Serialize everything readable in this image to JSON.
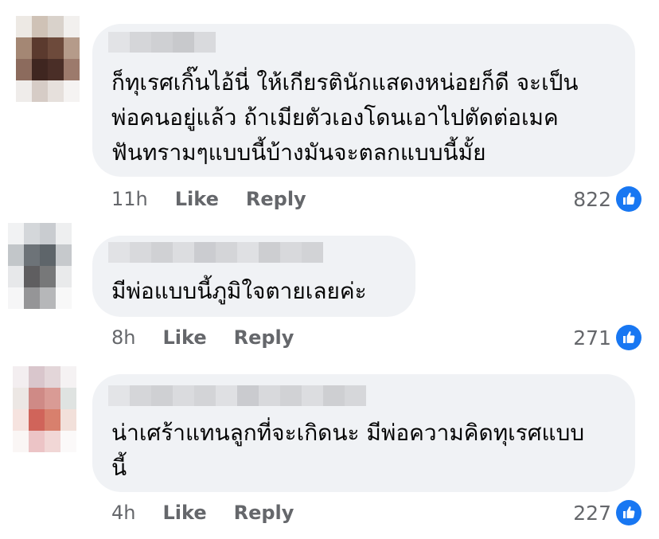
{
  "colors": {
    "bubble_bg": "#f0f2f5",
    "text": "#050505",
    "meta_text": "#65676b",
    "like_blue": "#1877f2"
  },
  "comments": [
    {
      "author_hidden": true,
      "avatar_icon": "blurred-avatar",
      "text": "ก็ทุเรศเกิ๊นไอ้นี่ ให้เกียรตินักแสดงหน่อยก็ดี จะเป็น\nพ่อคนอยู่แล้ว ถ้าเมียตัวเองโดนเอาไปตัดต่อเมค\nฟันทรามๆแบบนี้บ้างมันจะตลกแบบนี้มั้ย",
      "time": "11h",
      "like_label": "Like",
      "reply_label": "Reply",
      "reaction_count": "822",
      "reaction_icon": "like-icon"
    },
    {
      "author_hidden": true,
      "avatar_icon": "blurred-avatar",
      "text": "มีพ่อแบบนี้ภูมิใจตายเลยค่ะ",
      "time": "8h",
      "like_label": "Like",
      "reply_label": "Reply",
      "reaction_count": "271",
      "reaction_icon": "like-icon"
    },
    {
      "author_hidden": true,
      "avatar_icon": "blurred-avatar",
      "text": "น่าเศร้าแทนลูกที่จะเกิดนะ มีพ่อความคิดทุเรศแบบ\nนี้",
      "time": "4h",
      "like_label": "Like",
      "reply_label": "Reply",
      "reaction_count": "227",
      "reaction_icon": "like-icon"
    }
  ]
}
